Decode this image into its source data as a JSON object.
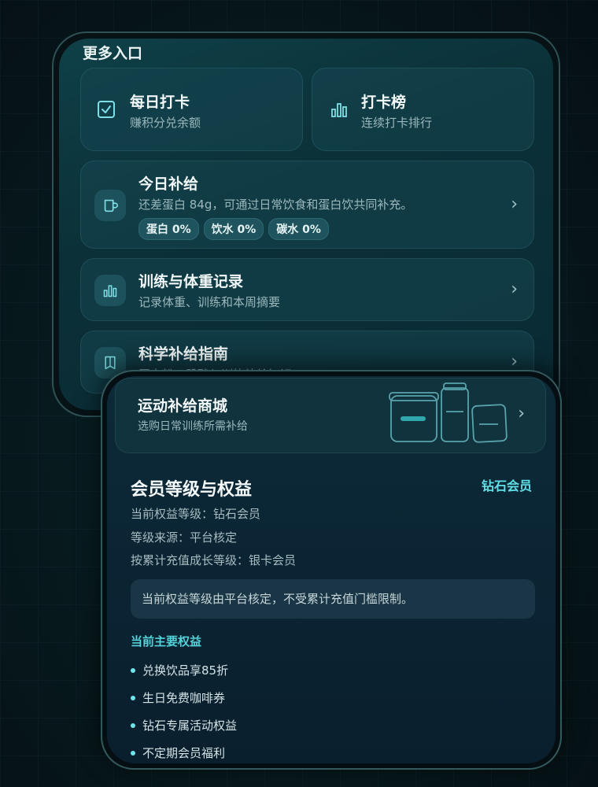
{
  "more_entries": {
    "title": "更多入口",
    "checkin": {
      "title": "每日打卡",
      "subtitle": "赚积分兑余额",
      "icon": "checkbox-icon"
    },
    "leaderboard": {
      "title": "打卡榜",
      "subtitle": "连续打卡排行",
      "icon": "bar-chart-icon"
    },
    "supply": {
      "title": "今日补给",
      "subtitle": "还差蛋白 84g，可通过日常饮食和蛋白饮共同补充。",
      "icon": "cup-icon",
      "pills": [
        "蛋白 0%",
        "饮水 0%",
        "碳水 0%"
      ]
    },
    "training": {
      "title": "训练与体重记录",
      "subtitle": "记录体重、训练和本周摘要",
      "icon": "bar-chart-icon"
    },
    "guide": {
      "title": "科学补给指南",
      "subtitle": "蛋白粉、肌酸与训练补给知识",
      "icon": "book-icon"
    }
  },
  "shop": {
    "title": "运动补给商城",
    "subtitle": "选购日常训练所需补给",
    "icon": "supplement-jars-illustration"
  },
  "membership": {
    "title": "会员等级与权益",
    "badge": "钻石会员",
    "lines": [
      "当前权益等级：钻石会员",
      "等级来源：平台核定",
      "按累计充值成长等级：银卡会员"
    ],
    "notice": "当前权益等级由平台核定，不受累计充值门槛限制。",
    "benefits_title": "当前主要权益",
    "benefits": [
      "兑换饮品享85折",
      "生日免费咖啡券",
      "钻石专属活动权益",
      "不定期会员福利"
    ]
  },
  "colors": {
    "accent": "#5fe0e6",
    "background": "#071a1e",
    "card": "#164650"
  }
}
